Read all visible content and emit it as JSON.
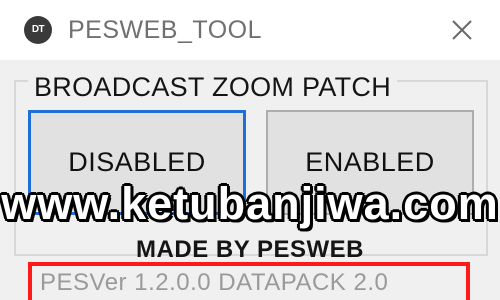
{
  "window": {
    "icon_text": "DT",
    "title": "PESWEB_TOOL",
    "close_label": "Close"
  },
  "group": {
    "title": "BROADCAST ZOOM PATCH"
  },
  "buttons": {
    "disabled_label": "DISABLED",
    "enabled_label": "ENABLED"
  },
  "footer": {
    "made_by": "MADE BY PESWEB",
    "version": "PESVer 1.2.0.0  DATAPACK 2.0"
  },
  "overlay": {
    "watermark": "www.ketubanjiwa.com"
  },
  "colors": {
    "focus_border": "#1f6fd6",
    "highlight_box": "#ff1a1a",
    "button_face": "#e1e1e1"
  }
}
